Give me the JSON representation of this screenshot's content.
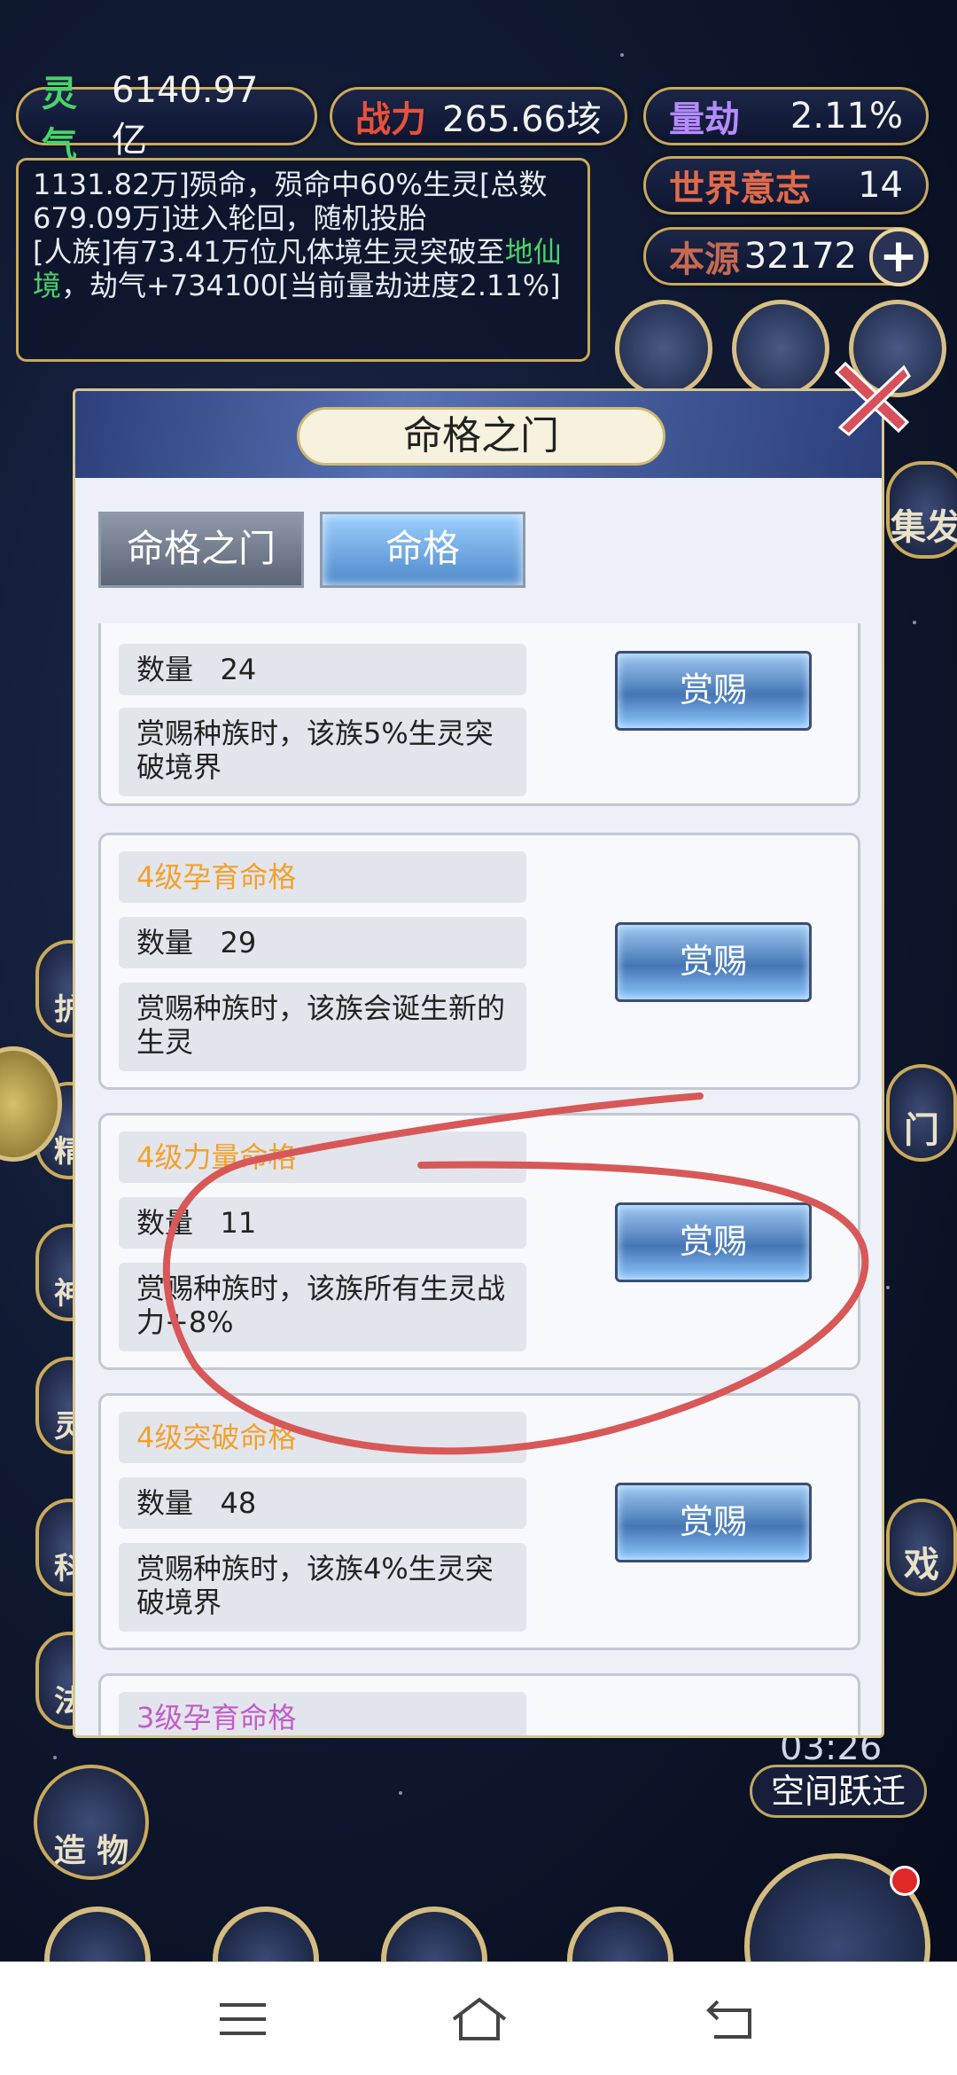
{
  "stats": {
    "lingqi": {
      "label": "灵气",
      "value": "6140.97亿",
      "color": "#49d36a"
    },
    "zhanli": {
      "label": "战力",
      "value": "265.66垓",
      "color": "#e8503a"
    },
    "liangjie": {
      "label": "量劫",
      "value": "2.11%",
      "color": "#b58bff"
    },
    "shijie": {
      "label": "世界意志",
      "value": "14",
      "color": "#e06b4a"
    },
    "benyuan": {
      "label": "本源",
      "value": "32172",
      "color": "#a44a3a"
    }
  },
  "log": {
    "line1": "1131.82万]殒命，殒命中60%生灵[总数679.09万]进入轮回，随机投胎",
    "line2a": "[人族]有73.41万位凡体境生灵突破至",
    "line2b": "地仙境",
    "line2c": "，劫气+734100[当前量劫进度2.11%]"
  },
  "side_labels": {
    "left1": "护",
    "left2": "精",
    "left3": "神",
    "left4": "灵",
    "left5": "科",
    "left6": "法",
    "left_bottom": "造 物",
    "right1": "集发",
    "right2": "门",
    "right3": "戏"
  },
  "modal": {
    "title": "命格之门",
    "tabs": [
      "命格之门",
      "命格"
    ],
    "active_tab": "命格",
    "qty_label": "数量",
    "reward_label": "赏赐",
    "cards": [
      {
        "title": "",
        "qty": "24",
        "desc": "赏赐种族时，该族5%生灵突破境界",
        "title_color": "#f2a12c"
      },
      {
        "title": "4级孕育命格",
        "qty": "29",
        "desc": "赏赐种族时，该族会诞生新的生灵",
        "title_color": "#f2a12c"
      },
      {
        "title": "4级力量命格",
        "qty": "11",
        "desc": "赏赐种族时，该族所有生灵战力+8%",
        "title_color": "#f2a12c"
      },
      {
        "title": "4级突破命格",
        "qty": "48",
        "desc": "赏赐种族时，该族4%生灵突破境界",
        "title_color": "#f2a12c"
      },
      {
        "title": "3级孕育命格",
        "qty": "",
        "desc": "",
        "title_color": "#c15cc9"
      }
    ]
  },
  "timer": "03:26",
  "jump_label": "空间跃迁",
  "annotation_color": "#d85858"
}
